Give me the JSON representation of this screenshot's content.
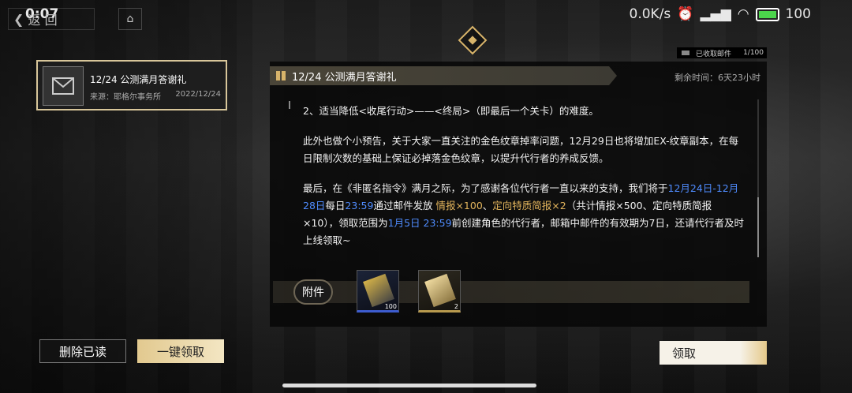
{
  "status_bar": {
    "time": "0:07",
    "network_speed": "0.0K/s",
    "battery": "100"
  },
  "nav": {
    "back_label": "返 回",
    "home_icon": "home-icon"
  },
  "mail_list": [
    {
      "title": "12/24 公测满月答谢礼",
      "source": "来源：耶格尔事务所",
      "date": "2022/12/24"
    }
  ],
  "mail_count": {
    "label": "已收取邮件",
    "value": "1/100"
  },
  "mail": {
    "title": "12/24 公测满月答谢礼",
    "remaining": "剩余时间：6天23小时",
    "para1": "2、适当降低<收尾行动>——<终局>（即最后一个关卡）的难度。",
    "para2": "此外也做个小预告，关于大家一直关注的金色纹章掉率问题，12月29日也将增加EX-纹章副本，在每日限制次数的基础上保证必掉落金色纹章，以提升代行者的养成反馈。",
    "para3": {
      "t1": "最后，在《非匿名指令》满月之际，为了感谢各位代行者一直以来的支持，我们将于",
      "date_range": "12月24日-12月28日",
      "t2": "每日",
      "time": "23:59",
      "t3": "通过邮件发放 ",
      "reward1": "情报×100",
      "t4": "、",
      "reward2": "定向特质简报×2",
      "t5": "（共计情报×500、定向特质简报×10），领取范围为",
      "deadline": "1月5日 23:59",
      "t6": "前创建角色的代行者，邮箱中邮件的有效期为7日，还请代行者及时上线领取~"
    }
  },
  "attachments": {
    "label": "附件",
    "items": [
      {
        "name": "情报",
        "qty": "100"
      },
      {
        "name": "定向特质简报",
        "qty": "2"
      }
    ]
  },
  "buttons": {
    "delete_read": "删除已读",
    "claim_all": "一键领取",
    "claim": "领取"
  },
  "colors": {
    "accent_gold": "#e2b45c",
    "link_blue": "#4f8cff",
    "selected_border": "#d8c69a"
  }
}
